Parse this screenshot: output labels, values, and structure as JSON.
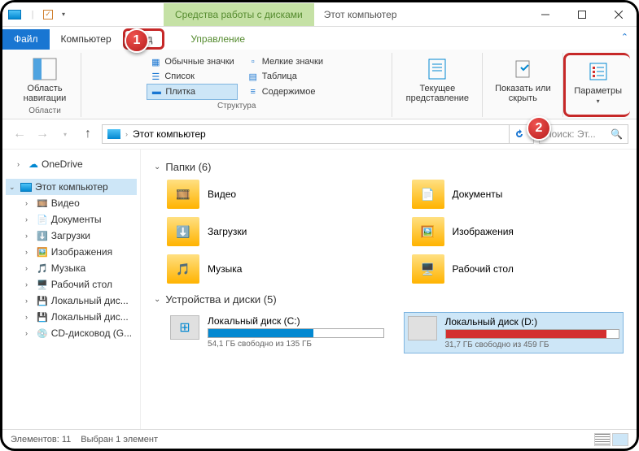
{
  "titlebar": {
    "contextual": "Средства работы с дисками",
    "title": "Этот компьютер"
  },
  "tabs": {
    "file": "Файл",
    "computer": "Компьютер",
    "view": "Вид",
    "manage": "Управление"
  },
  "ribbon": {
    "nav_pane": "Область навигации",
    "group_areas": "Области",
    "layout": {
      "normal_icons": "Обычные значки",
      "small_icons": "Мелкие значки",
      "list": "Список",
      "table": "Таблица",
      "tiles": "Плитка",
      "content": "Содержимое"
    },
    "group_layout": "Структура",
    "current_view": "Текущее представление",
    "show_hide": "Показать или скрыть",
    "options": "Параметры"
  },
  "address": {
    "path": "Этот компьютер"
  },
  "search": {
    "placeholder": "Поиск: Эт..."
  },
  "sidebar": {
    "onedrive": "OneDrive",
    "this_pc": "Этот компьютер",
    "items": [
      {
        "label": "Видео"
      },
      {
        "label": "Документы"
      },
      {
        "label": "Загрузки"
      },
      {
        "label": "Изображения"
      },
      {
        "label": "Музыка"
      },
      {
        "label": "Рабочий стол"
      },
      {
        "label": "Локальный дис..."
      },
      {
        "label": "Локальный дис..."
      },
      {
        "label": "CD-дисковод (G..."
      }
    ]
  },
  "content": {
    "folders_header": "Папки (6)",
    "folders": [
      {
        "label": "Видео",
        "overlay": "🎞️"
      },
      {
        "label": "Документы",
        "overlay": "📄"
      },
      {
        "label": "Загрузки",
        "overlay": "⬇️"
      },
      {
        "label": "Изображения",
        "overlay": "🖼️"
      },
      {
        "label": "Музыка",
        "overlay": "🎵"
      },
      {
        "label": "Рабочий стол",
        "overlay": "🖥️"
      }
    ],
    "drives_header": "Устройства и диски (5)",
    "drives": [
      {
        "label": "Локальный диск (C:)",
        "meta": "54,1 ГБ свободно из 135 ГБ",
        "fill": 60,
        "color": "#0288d1",
        "selected": false,
        "win": true
      },
      {
        "label": "Локальный диск (D:)",
        "meta": "31,7 ГБ свободно из 459 ГБ",
        "fill": 93,
        "color": "#d32f2f",
        "selected": true,
        "win": false
      }
    ]
  },
  "status": {
    "elements": "Элементов: 11",
    "selected": "Выбран 1 элемент"
  },
  "badges": {
    "b1": "1",
    "b2": "2"
  }
}
